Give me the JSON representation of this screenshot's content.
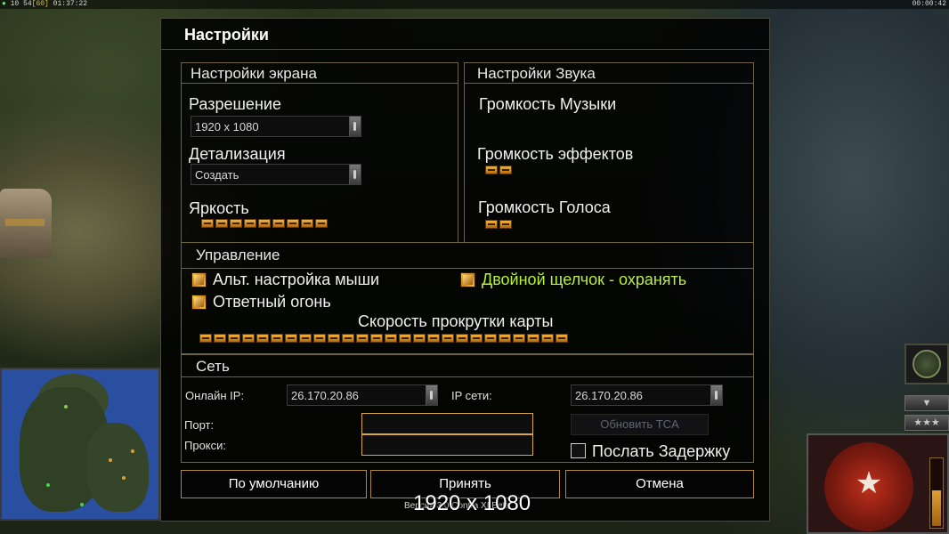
{
  "hud": {
    "top_left_prefix": "10",
    "top_left_stat": "54",
    "top_left_fps": "[60]",
    "top_left_time": "01:37:22",
    "top_right_time": "00:00:42"
  },
  "dialog": {
    "title": "Настройки",
    "screen": {
      "title": "Настройки экрана",
      "resolution_label": "Разрешение",
      "resolution_value": "1920 x 1080",
      "detail_label": "Детализация",
      "detail_value": "Создать",
      "brightness_label": "Яркость",
      "brightness_level": 9
    },
    "sound": {
      "title": "Настройки Звука",
      "music_label": "Громкость Музыки",
      "music_level": 0,
      "effects_label": "Громкость эффектов",
      "effects_level": 2,
      "voice_label": "Громкость Голоса",
      "voice_level": 2
    },
    "controls": {
      "title": "Управление",
      "alt_mouse_label": "Альт. настройка мыши",
      "alt_mouse_checked": true,
      "double_click_label": "Двойной щелчок - охранять",
      "double_click_checked": true,
      "double_click_color": "#b8f03a",
      "retaliation_label": "Ответный огонь",
      "retaliation_checked": true,
      "scroll_speed_label": "Скорость прокрутки карты",
      "scroll_speed_level": 26
    },
    "network": {
      "title": "Сеть",
      "online_ip_label": "Онлайн IP:",
      "online_ip_value": "26.170.20.86",
      "lan_ip_label": "IP сети:",
      "lan_ip_value": "26.170.20.86",
      "port_label": "Порт:",
      "port_value": "",
      "proxy_label": "Прокси:",
      "proxy_value": "",
      "update_tca_label": "Обновить TCA",
      "send_delay_label": "Послать Задержку",
      "send_delay_checked": false
    },
    "buttons": {
      "default_label": "По умолчанию",
      "accept_label": "Принять",
      "cancel_label": "Отмена"
    }
  },
  "overlay": {
    "resolution_text": "1920 x 1080",
    "version_text": "Версия 3.0 Contra XI Beta"
  },
  "colors": {
    "accent_orange": "#f4b23a",
    "panel_border": "#6e6442",
    "button_border": "#b08a3a"
  }
}
